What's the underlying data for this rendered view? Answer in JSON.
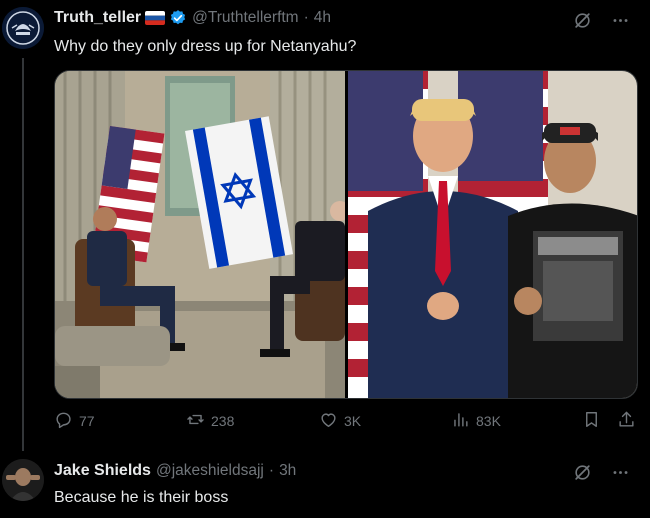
{
  "tweet": {
    "author_name": "Truth_teller",
    "handle": "@Truthtellerftm",
    "separator": "·",
    "time": "4h",
    "text": "Why do they only dress up for Netanyahu?",
    "stats": {
      "replies": "77",
      "retweets": "238",
      "likes": "3K",
      "views": "83K"
    }
  },
  "reply": {
    "author_name": "Jake Shields",
    "handle": "@jakeshieldsajj",
    "separator": "·",
    "time": "3h",
    "text": "Because he is their boss"
  },
  "colors": {
    "background": "#000000",
    "text": "#e7e9ea",
    "muted": "#71767b",
    "verified": "#1d9bf0",
    "divider": "#333639"
  },
  "icons": [
    "grok-icon",
    "more-icon",
    "reply-icon",
    "retweet-icon",
    "like-icon",
    "views-icon",
    "bookmark-icon",
    "share-icon",
    "verified-badge-icon"
  ]
}
